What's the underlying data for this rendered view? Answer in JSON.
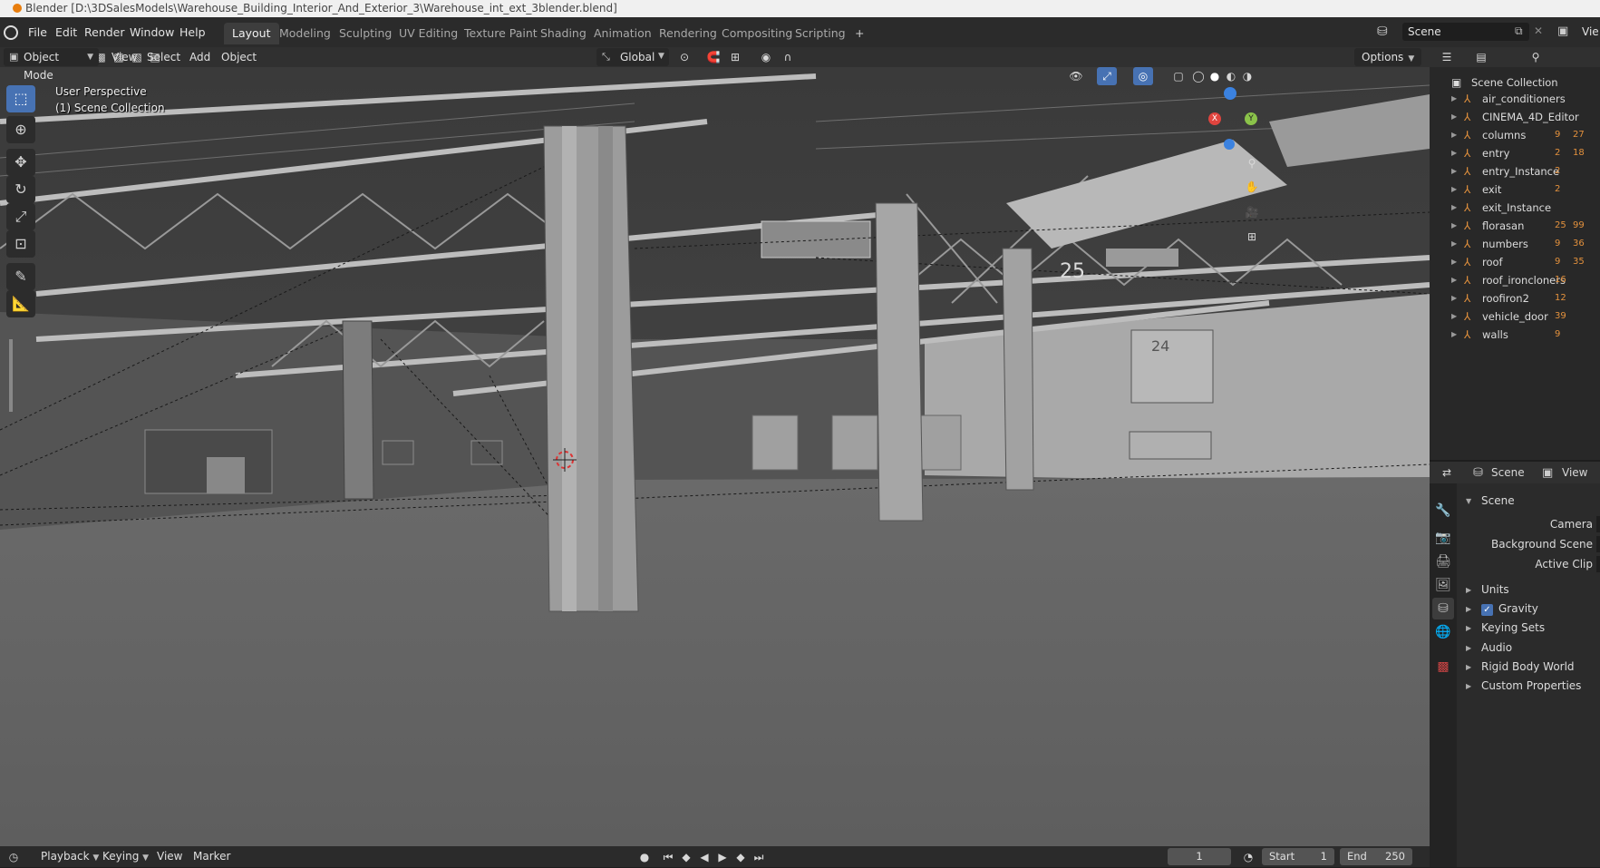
{
  "titlebar": {
    "text": "Blender [D:\\3DSalesModels\\Warehouse_Building_Interior_And_Exterior_3\\Warehouse_int_ext_3blender.blend]"
  },
  "topbar": {
    "menus": [
      "File",
      "Edit",
      "Render",
      "Window",
      "Help"
    ],
    "workspaces": [
      "Layout",
      "Modeling",
      "Sculpting",
      "UV Editing",
      "Texture Paint",
      "Shading",
      "Animation",
      "Rendering",
      "Compositing",
      "Scripting"
    ],
    "active_workspace": "Layout",
    "add_tab": "+",
    "scene_name": "Scene",
    "view_layer": "Vie"
  },
  "viewport_header": {
    "mode": "Object Mode",
    "menus": [
      "View",
      "Select",
      "Add",
      "Object"
    ],
    "transform_orientation": "Global",
    "options": "Options"
  },
  "viewport": {
    "perspective": "User Perspective",
    "collection": "(1) Scene Collection",
    "bay_numbers": [
      "25",
      "24"
    ],
    "axis_labels": {
      "x": "X",
      "y": "Y"
    }
  },
  "outliner": {
    "root": "Scene Collection",
    "items": [
      {
        "name": "air_conditioners",
        "badges": []
      },
      {
        "name": "CINEMA_4D_Editor",
        "badges": []
      },
      {
        "name": "columns",
        "badges": [
          "9",
          "27"
        ]
      },
      {
        "name": "entry",
        "badges": [
          "2",
          "18"
        ]
      },
      {
        "name": "entry_Instance",
        "badges": [
          "2"
        ]
      },
      {
        "name": "exit",
        "badges": [
          "2"
        ]
      },
      {
        "name": "exit_Instance",
        "badges": []
      },
      {
        "name": "florasan",
        "badges": [
          "25",
          "99"
        ]
      },
      {
        "name": "numbers",
        "badges": [
          "9",
          "36"
        ]
      },
      {
        "name": "roof",
        "badges": [
          "9",
          "35"
        ]
      },
      {
        "name": "roof_ironcloners",
        "badges": [
          "16"
        ]
      },
      {
        "name": "roofiron2",
        "badges": [
          "12"
        ]
      },
      {
        "name": "vehicle_door",
        "badges": [
          "39"
        ]
      },
      {
        "name": "walls",
        "badges": [
          "9"
        ]
      }
    ]
  },
  "properties": {
    "header_scene": "Scene",
    "header_view": "View",
    "panel_title": "Scene",
    "fields": [
      "Camera",
      "Background Scene",
      "Active Clip"
    ],
    "subpanels": [
      "Units",
      "Gravity",
      "Keying Sets",
      "Audio",
      "Rigid Body World",
      "Custom Properties"
    ],
    "gravity_checked": true
  },
  "timeline": {
    "menus": [
      "Playback",
      "Keying",
      "View",
      "Marker"
    ],
    "current_frame": "1",
    "start_label": "Start",
    "start_value": "1",
    "end_label": "End",
    "end_value": "250"
  },
  "colors": {
    "accent": "#4772b3",
    "object_orange": "#e3913d",
    "axis_x": "#e0443e",
    "axis_y": "#8bc34a",
    "axis_z": "#3b82e0"
  }
}
